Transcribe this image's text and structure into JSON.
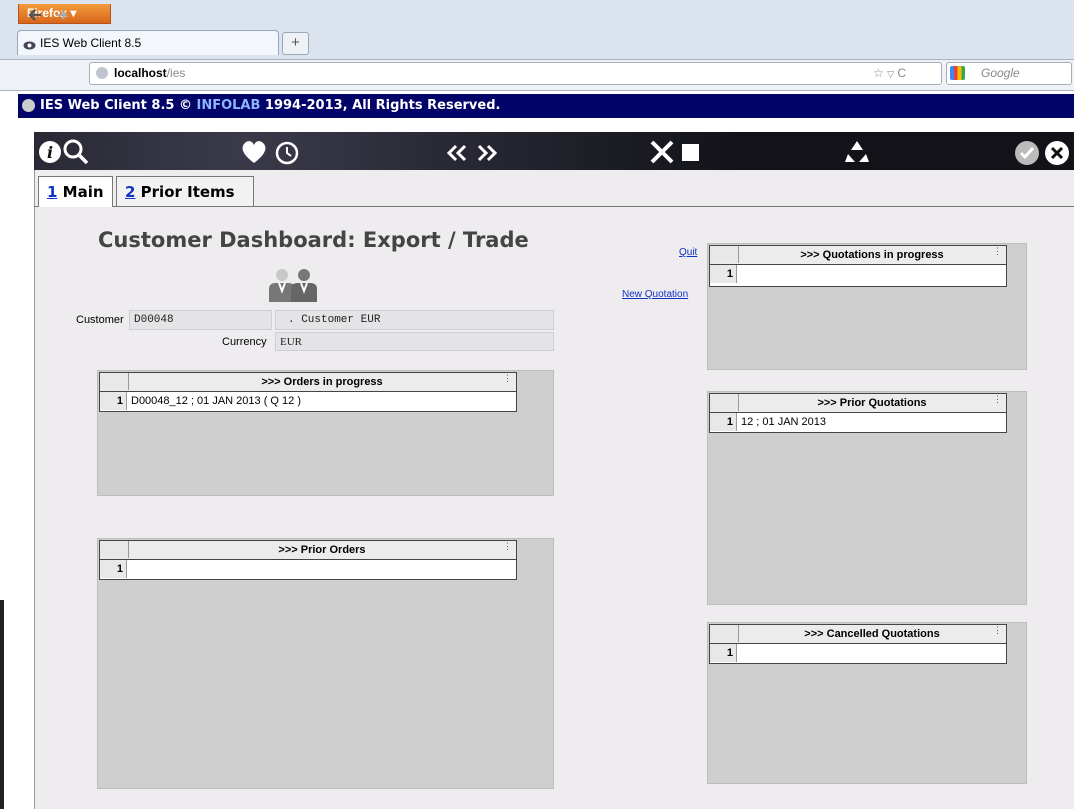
{
  "browser": {
    "menu_button": "Firefox ▾",
    "tab_title": "IES Web Client 8.5",
    "new_tab": "+",
    "url_host": "localhost",
    "url_path": "/ies",
    "search_placeholder": "Google"
  },
  "app_header": {
    "prefix": "IES Web Client 8.5 © ",
    "brand": "INFOLAB",
    "suffix": " 1994-2013, All Rights Reserved."
  },
  "toolbar_icons": [
    "info-icon",
    "search-icon",
    "heart-icon",
    "clock-icon",
    "prev-icon",
    "next-icon",
    "tools-icon",
    "stop-icon",
    "recycle-icon",
    "check-icon",
    "close-icon"
  ],
  "tabs": [
    {
      "num": "1",
      "label": " Main"
    },
    {
      "num": "2",
      "label": " Prior Items"
    }
  ],
  "page_title": "Customer Dashboard: Export / Trade",
  "links": {
    "quit": "Quit",
    "new_quotation": "New Quotation"
  },
  "customer": {
    "label": "Customer",
    "code": "D00048",
    "name": ". Customer EUR",
    "currency_label": "Currency",
    "currency": "EUR"
  },
  "grids": {
    "orders_in_progress": {
      "title": ">>> Orders in progress",
      "rows": [
        {
          "n": "1",
          "v": "D00048_12 ; 01 JAN 2013 ( Q 12 )"
        }
      ]
    },
    "prior_orders": {
      "title": ">>> Prior Orders",
      "rows": [
        {
          "n": "1",
          "v": ""
        }
      ]
    },
    "quotations_in_progress": {
      "title": ">>> Quotations in progress",
      "rows": [
        {
          "n": "1",
          "v": ""
        }
      ]
    },
    "prior_quotations": {
      "title": ">>> Prior Quotations",
      "rows": [
        {
          "n": "1",
          "v": "12 ; 01 JAN 2013"
        }
      ]
    },
    "cancelled_quotations": {
      "title": ">>> Cancelled Quotations",
      "rows": [
        {
          "n": "1",
          "v": ""
        }
      ]
    }
  },
  "colors": {
    "header_bg": "#020469",
    "link": "#1033c4",
    "grid_bg": "#cfcfcf",
    "app_bg": "#eeecef"
  }
}
